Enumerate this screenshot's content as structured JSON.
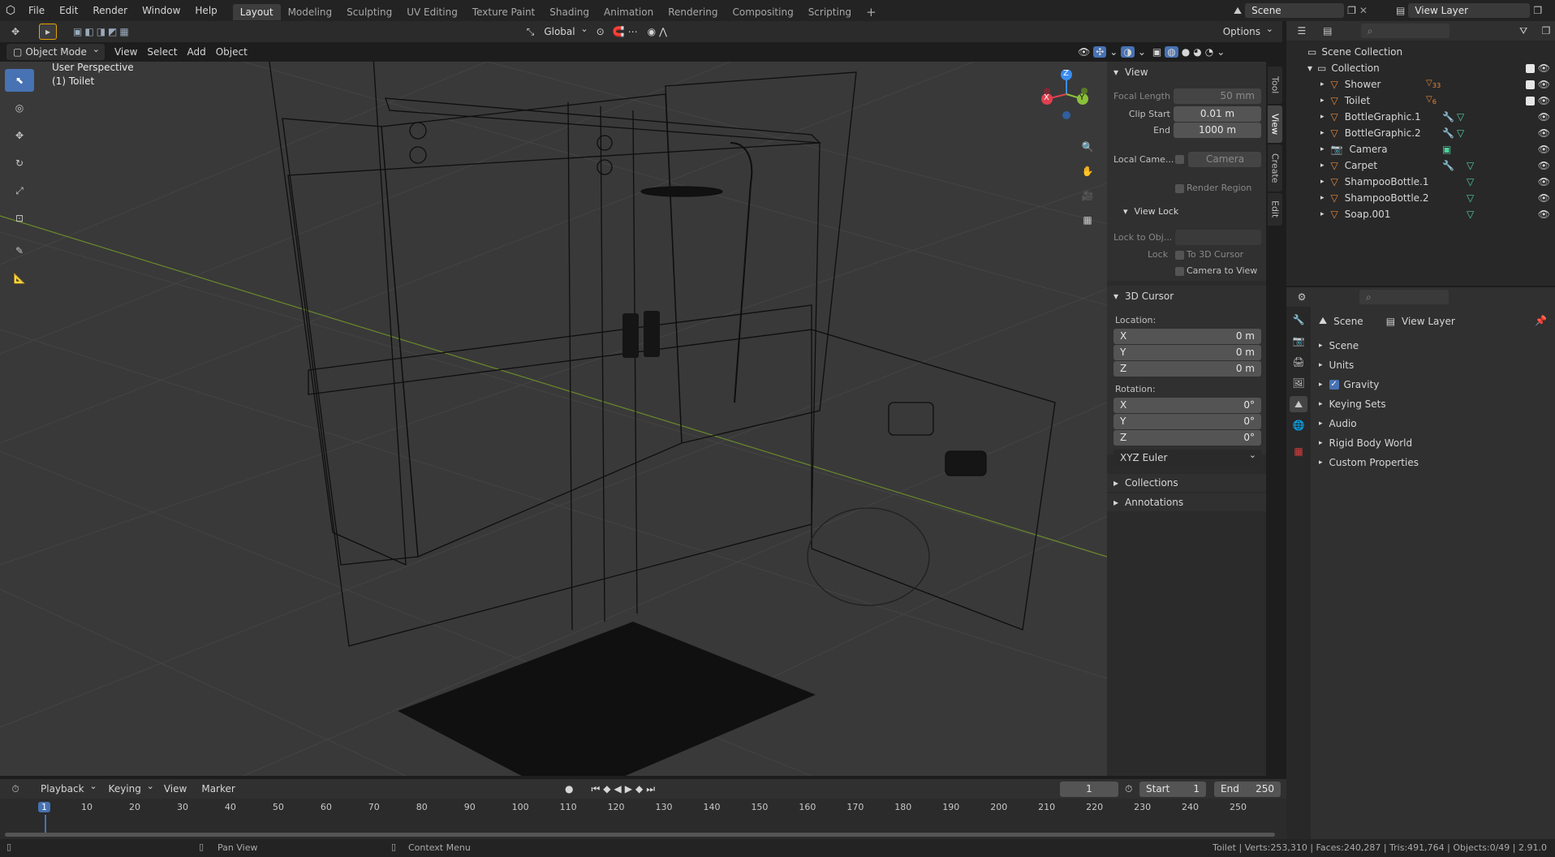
{
  "topbar": {
    "menus": [
      "File",
      "Edit",
      "Render",
      "Window",
      "Help"
    ],
    "workspaces": [
      "Layout",
      "Modeling",
      "Sculpting",
      "UV Editing",
      "Texture Paint",
      "Shading",
      "Animation",
      "Rendering",
      "Compositing",
      "Scripting"
    ],
    "active_workspace": "Layout",
    "scene": "Scene",
    "view_layer": "View Layer"
  },
  "viewport_header": {
    "mode": "Object Mode",
    "menus": [
      "View",
      "Select",
      "Add",
      "Object"
    ],
    "orientation": "Global",
    "options": "Options"
  },
  "viewport": {
    "perspective": "User Perspective",
    "active_object": "(1) Toilet",
    "gizmo": {
      "x": "X",
      "y": "Y",
      "z": "Z"
    }
  },
  "npanel": {
    "tabs": [
      "Tool",
      "View",
      "Create",
      "Edit"
    ],
    "view_section": "View",
    "focal_length_label": "Focal Length",
    "focal_length": "50 mm",
    "clip_start_label": "Clip Start",
    "clip_start": "0.01 m",
    "end_label": "End",
    "end": "1000 m",
    "local_camera_label": "Local Came...",
    "local_camera": "Camera",
    "render_region": "Render Region",
    "view_lock": "View Lock",
    "lock_to_obj": "Lock to Obj...",
    "lock_label": "Lock",
    "to_3d_cursor": "To 3D Cursor",
    "camera_to_view": "Camera to View",
    "cursor_section": "3D Cursor",
    "location_label": "Location:",
    "loc": [
      {
        "axis": "X",
        "value": "0 m"
      },
      {
        "axis": "Y",
        "value": "0 m"
      },
      {
        "axis": "Z",
        "value": "0 m"
      }
    ],
    "rotation_label": "Rotation:",
    "rot": [
      {
        "axis": "X",
        "value": "0°"
      },
      {
        "axis": "Y",
        "value": "0°"
      },
      {
        "axis": "Z",
        "value": "0°"
      }
    ],
    "rotation_mode": "XYZ Euler",
    "collections": "Collections",
    "annotations": "Annotations"
  },
  "outliner": {
    "root": "Scene Collection",
    "collection": "Collection",
    "items": [
      {
        "name": "Shower",
        "icon": "empty-icon"
      },
      {
        "name": "Toilet",
        "icon": "empty-icon"
      },
      {
        "name": "BottleGraphic.1",
        "icon": "mesh-icon"
      },
      {
        "name": "BottleGraphic.2",
        "icon": "mesh-icon"
      },
      {
        "name": "Camera",
        "icon": "camera-icon"
      },
      {
        "name": "Carpet",
        "icon": "mesh-icon"
      },
      {
        "name": "ShampooBottle.1",
        "icon": "mesh-icon"
      },
      {
        "name": "ShampooBottle.2",
        "icon": "mesh-icon"
      },
      {
        "name": "Soap.001",
        "icon": "mesh-icon"
      }
    ],
    "badges": {
      "shower": "33",
      "toilet": "6"
    }
  },
  "properties": {
    "scene": "Scene",
    "view_layer": "View Layer",
    "sections": [
      "Scene",
      "Units",
      "Gravity",
      "Keying Sets",
      "Audio",
      "Rigid Body World",
      "Custom Properties"
    ]
  },
  "timeline": {
    "menus": [
      "Playback",
      "Keying",
      "View",
      "Marker"
    ],
    "current_frame": "1",
    "start_label": "Start",
    "start": "1",
    "end_label": "End",
    "end": "250",
    "ticks": [
      "1",
      "10",
      "20",
      "30",
      "40",
      "50",
      "60",
      "70",
      "80",
      "90",
      "100",
      "110",
      "120",
      "130",
      "140",
      "150",
      "160",
      "170",
      "180",
      "190",
      "200",
      "210",
      "220",
      "230",
      "240",
      "250"
    ]
  },
  "statusbar": {
    "pan": "Pan View",
    "context": "Context Menu",
    "stats": "Toilet | Verts:253,310 | Faces:240,287 | Tris:491,764 | Objects:0/49 | 2.91.0"
  },
  "colors": {
    "accent": "#4772b3",
    "mesh": "#e8883a",
    "modifier": "#6aa6e0",
    "meshdata": "#4fcf9c"
  }
}
